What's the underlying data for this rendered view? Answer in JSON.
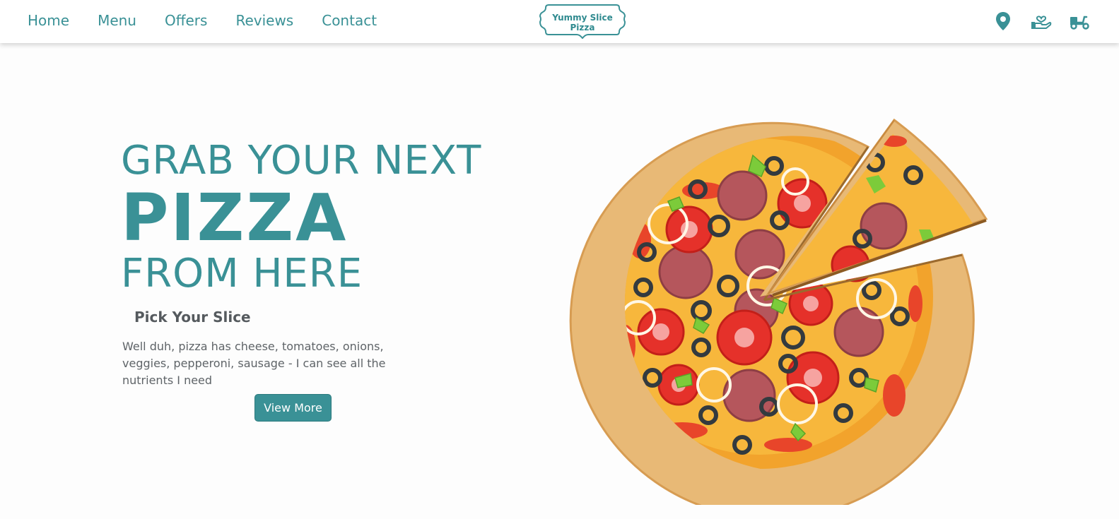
{
  "nav": {
    "links": [
      "Home",
      "Menu",
      "Offers",
      "Reviews",
      "Contact"
    ]
  },
  "logo": {
    "text": "Yummy Slice Pizza"
  },
  "nav_icons": [
    "location-pin-icon",
    "hand-heart-icon",
    "delivery-scooter-icon"
  ],
  "hero": {
    "line1": "GRAB YOUR NEXT",
    "line2": "PIZZA",
    "line3": "FROM HERE",
    "subtitle": "Pick Your Slice",
    "description": "Well duh, pizza has cheese, tomatoes, onions, veggies, pepperoni, sausage - I can see all the nutrients I need",
    "button": "View More"
  },
  "colors": {
    "accent": "#3a9196",
    "text_dark": "#555a5e",
    "text_body": "#5f6468"
  }
}
